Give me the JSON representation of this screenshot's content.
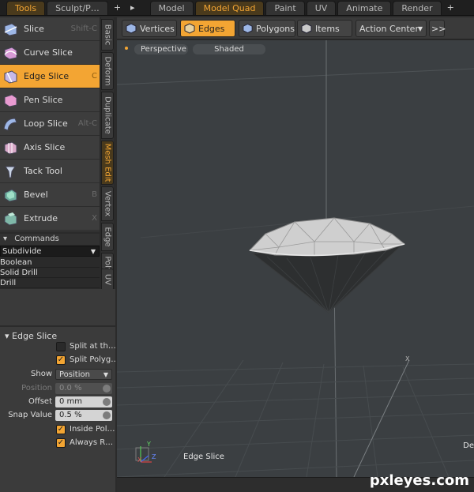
{
  "top_tabs": [
    {
      "label": "Tools",
      "active": true
    },
    {
      "label": "Sculpt/P…",
      "active": false
    },
    {
      "label": "+",
      "plain": true
    },
    {
      "label": "▸",
      "plain": true
    },
    {
      "label": "Model",
      "active": false
    },
    {
      "label": "Model Quad",
      "active": true
    },
    {
      "label": "Paint",
      "active": false
    },
    {
      "label": "UV",
      "active": false
    },
    {
      "label": "Animate",
      "active": false
    },
    {
      "label": "Render",
      "active": false
    },
    {
      "label": "+",
      "plain": true
    }
  ],
  "tools": [
    {
      "label": "Slice",
      "key": "Shift-C",
      "icon": "slice-icon",
      "active": false
    },
    {
      "label": "Curve Slice",
      "key": "",
      "icon": "curve-slice-icon",
      "active": false
    },
    {
      "label": "Edge Slice",
      "key": "C",
      "icon": "edge-slice-icon",
      "active": true
    },
    {
      "label": "Pen Slice",
      "key": "",
      "icon": "pen-slice-icon",
      "active": false
    },
    {
      "label": "Loop Slice",
      "key": "Alt-C",
      "icon": "loop-slice-icon",
      "active": false
    },
    {
      "label": "Axis Slice",
      "key": "",
      "icon": "axis-slice-icon",
      "active": false
    },
    {
      "label": "Tack Tool",
      "key": "",
      "icon": "tack-tool-icon",
      "active": false
    },
    {
      "label": "Bevel",
      "key": "B",
      "icon": "bevel-icon",
      "active": false
    },
    {
      "label": "Extrude",
      "key": "X",
      "icon": "extrude-icon",
      "active": false
    }
  ],
  "side_tabs": [
    {
      "label": "Basic",
      "active": false
    },
    {
      "label": "Deform",
      "active": false
    },
    {
      "label": "Duplicate",
      "active": false
    },
    {
      "label": "Mesh Edit",
      "active": true
    },
    {
      "label": "Vertex",
      "active": false
    },
    {
      "label": "Edge",
      "active": false
    },
    {
      "label": "Polygon",
      "active": false
    },
    {
      "label": "UV",
      "active": false
    }
  ],
  "commands": {
    "header": "Commands",
    "selected": "Subdivide",
    "items": [
      "Boolean",
      "Solid Drill",
      "Drill"
    ]
  },
  "properties": {
    "title": "Edge Slice",
    "split_at_the": {
      "label": "Split at th…",
      "checked": false
    },
    "split_polygons": {
      "label": "Split Polyg…",
      "checked": true
    },
    "show": {
      "label": "Show",
      "value": "Position"
    },
    "position": {
      "label": "Position",
      "value": "0.0 %"
    },
    "offset": {
      "label": "Offset",
      "value": "0 mm"
    },
    "snap_value": {
      "label": "Snap Value",
      "value": "0.5 %"
    },
    "inside_poly": {
      "label": "Inside Pol…",
      "checked": true
    },
    "always_r": {
      "label": "Always R…",
      "checked": true
    }
  },
  "viewport_toolbar": {
    "vertices": "Vertices",
    "edges": "Edges",
    "polygons": "Polygons",
    "items": "Items",
    "action_center": "Action Center",
    "more": ">>"
  },
  "viewport": {
    "view_mode": "Perspective",
    "shading": "Shaded",
    "tool_caption": "Edge Slice",
    "right_clip": "De",
    "axis_labels": {
      "y": "Y",
      "x": "X",
      "z": "Z"
    }
  },
  "watermark": "pxleyes.com"
}
